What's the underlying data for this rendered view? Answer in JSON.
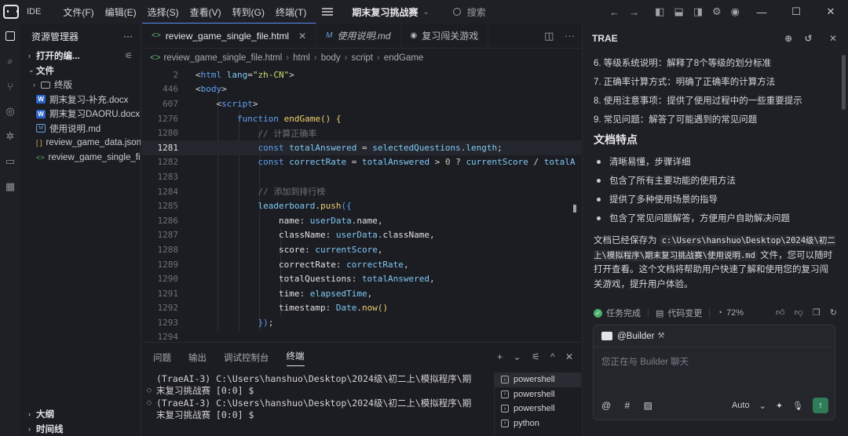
{
  "titlebar": {
    "app_label": "IDE",
    "menus": [
      "文件(F)",
      "编辑(E)",
      "选择(S)",
      "查看(V)",
      "转到(G)",
      "终端(T)"
    ],
    "project": "期末复习挑战赛",
    "search_placeholder": "搜索"
  },
  "explorer": {
    "title": "资源管理器",
    "open_editors": "打开的编...",
    "folder": "文件",
    "items": [
      {
        "name": "终版",
        "type": "folder"
      },
      {
        "name": "期末复习-补充.docx",
        "type": "docx"
      },
      {
        "name": "期末复习DAORU.docx",
        "type": "docx"
      },
      {
        "name": "使用说明.md",
        "type": "md"
      },
      {
        "name": "review_game_data.json",
        "type": "json"
      },
      {
        "name": "review_game_single_fi...",
        "type": "html"
      }
    ],
    "outline": "大纲",
    "timeline": "时间线"
  },
  "editor": {
    "tabs": [
      {
        "label": "review_game_single_file.html",
        "active": true
      },
      {
        "label": "使用说明.md",
        "active": false
      },
      {
        "label": "复习闯关游戏",
        "active": false
      }
    ],
    "breadcrumb": [
      "review_game_single_file.html",
      "html",
      "body",
      "script",
      "endGame"
    ],
    "current_line": "1281",
    "line_numbers": [
      "2",
      "446",
      "607",
      "1276",
      "1280",
      "1281",
      "1282",
      "1283",
      "1284",
      "1285",
      "1286",
      "1287",
      "1288",
      "1289",
      "1290",
      "1291",
      "1292",
      "1293",
      "1294"
    ]
  },
  "panel": {
    "tabs": [
      "问题",
      "输出",
      "调试控制台",
      "终端"
    ],
    "active_tab": "终端",
    "terminal_lines": [
      "(TraeAI-3) C:\\Users\\hanshuo\\Desktop\\2024级\\初二上\\模拟程序\\期",
      "末复习挑战赛 [0:0] $",
      "(TraeAI-3) C:\\Users\\hanshuo\\Desktop\\2024级\\初二上\\模拟程序\\期",
      "末复习挑战赛 [0:0] $"
    ],
    "shells": [
      "powershell",
      "powershell",
      "powershell",
      "python"
    ]
  },
  "chat": {
    "title": "TRAE",
    "ordered": [
      "6. 等级系统说明：解释了8个等级的划分标准",
      "7. 正确率计算方式：明确了正确率的计算方法",
      "8. 使用注意事项：提供了使用过程中的一些重要提示",
      "9. 常见问题：解答了可能遇到的常见问题"
    ],
    "heading": "文档特点",
    "bullets": [
      "清晰易懂，步骤详细",
      "包含了所有主要功能的使用方法",
      "提供了多种使用场景的指导",
      "包含了常见问题解答，方便用户自助解决问题"
    ],
    "para_pre": "文档已经保存为 ",
    "para_code": "c:\\Users\\hanshuo\\Desktop\\2024级\\初二上\\模拟程序\\期末复习挑战赛\\使用说明.md",
    "para_post": " 文件，您可以随时打开查看。这个文档将帮助用户快速了解和使用您的复习闯关游戏，提升用户体验。",
    "status_done": "任务完成",
    "status_diff": "代码变更",
    "status_progress": "72%",
    "builder": "@Builder",
    "composer_placeholder": "您正在与 Builder 聊天",
    "mode": "Auto"
  }
}
